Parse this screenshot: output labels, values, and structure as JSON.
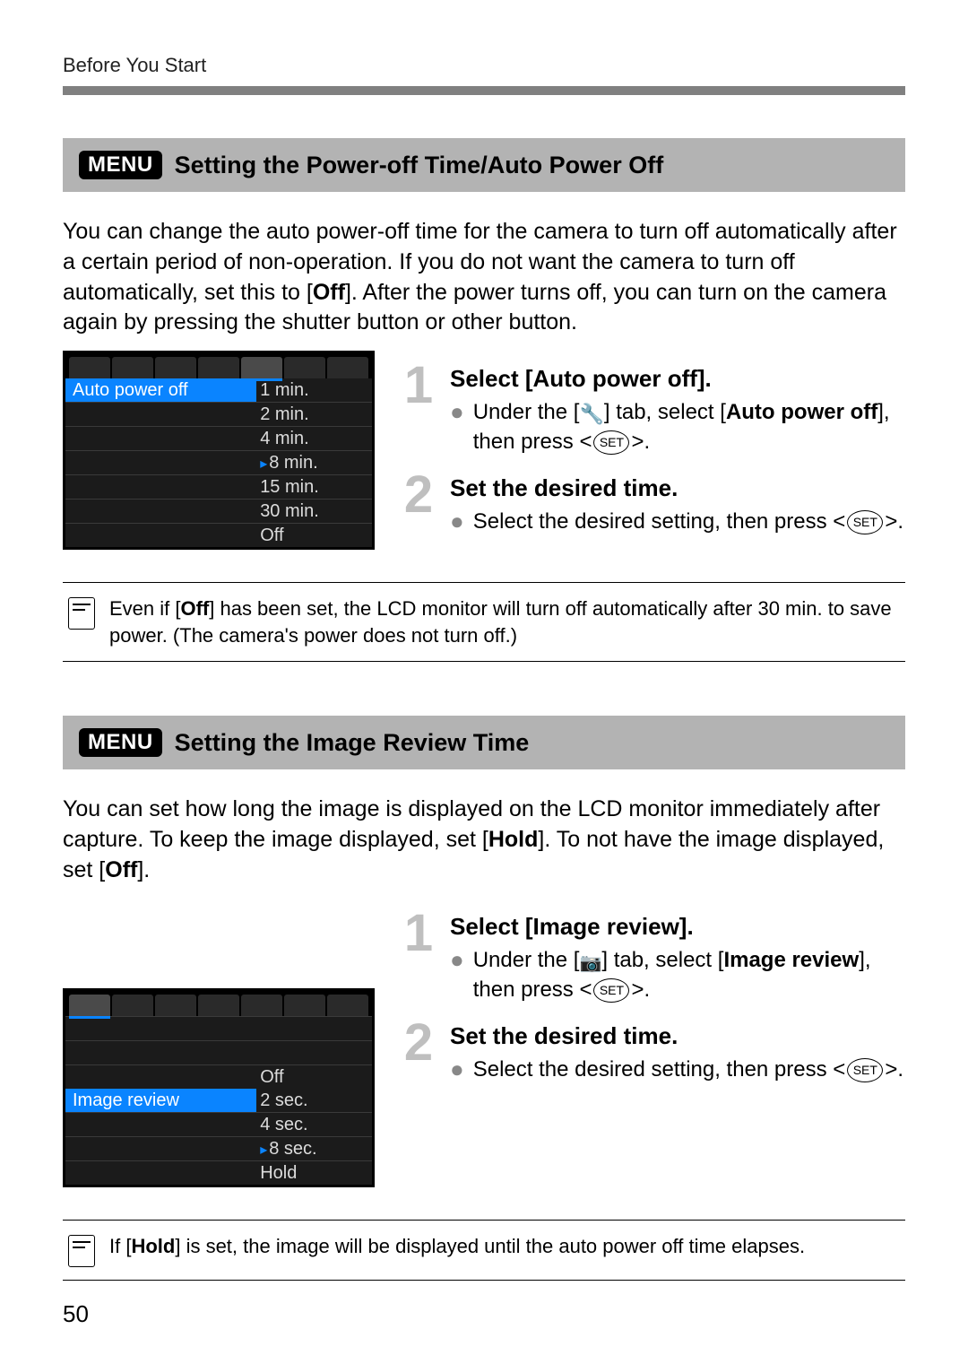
{
  "page": {
    "running_head": "Before You Start",
    "page_number": "50"
  },
  "menu_label": "MENU",
  "section1": {
    "title": "Setting the Power-off Time/Auto Power Off",
    "intro_pre": "You can change the auto power-off time for the camera to turn off automatically after a certain period of non-operation. If you do not want the camera to turn off automatically, set this to [",
    "intro_bold": "Off",
    "intro_post": "]. After the power turns off, you can turn on the camera again by pressing the shutter button or other button.",
    "lcd": {
      "highlight_label": "Auto power off",
      "options": [
        "1 min.",
        "2 min.",
        "4 min.",
        "8 min.",
        "15 min.",
        "30 min.",
        "Off"
      ],
      "selected_index": 3,
      "active_tab_index": 4,
      "tab_count": 7
    },
    "step1": {
      "num": "1",
      "title": "Select [Auto power off].",
      "bullet_pre": "Under the [",
      "bullet_mid": "] tab, select [",
      "bullet_bold": "Auto power off",
      "bullet_post": "], then press <",
      "bullet_end": ">.",
      "set_label": "SET"
    },
    "step2": {
      "num": "2",
      "title": "Set the desired time.",
      "bullet_text": "Select the desired setting, then press <",
      "bullet_end": ">.",
      "set_label": "SET"
    },
    "note_pre": "Even if [",
    "note_bold": "Off",
    "note_post": "] has been set, the LCD monitor will turn off automatically after 30 min. to save power. (The camera's power does not turn off.)"
  },
  "section2": {
    "title": "Setting the Image Review Time",
    "intro_pre": "You can set how long the image is displayed on the LCD monitor immediately after capture. To keep the image displayed, set [",
    "intro_bold1": "Hold",
    "intro_mid": "]. To not have the image displayed, set [",
    "intro_bold2": "Off",
    "intro_post": "].",
    "lcd": {
      "highlight_label": "Image review",
      "pre_blank_rows": 2,
      "options": [
        "Off",
        "2 sec.",
        "4 sec.",
        "8 sec.",
        "Hold"
      ],
      "selected_index": 3,
      "active_tab_index": 0,
      "tab_count": 7
    },
    "step1": {
      "num": "1",
      "title": "Select [Image review].",
      "bullet_pre": "Under the [",
      "bullet_mid": "] tab, select [",
      "bullet_bold": "Image review",
      "bullet_post": "], then press <",
      "bullet_end": ">.",
      "set_label": "SET"
    },
    "step2": {
      "num": "2",
      "title": "Set the desired time.",
      "bullet_text": "Select the desired setting, then press <",
      "bullet_end": ">.",
      "set_label": "SET"
    },
    "note_pre": "If [",
    "note_bold": "Hold",
    "note_post": "] is set, the image will be displayed until the auto power off time elapses."
  }
}
